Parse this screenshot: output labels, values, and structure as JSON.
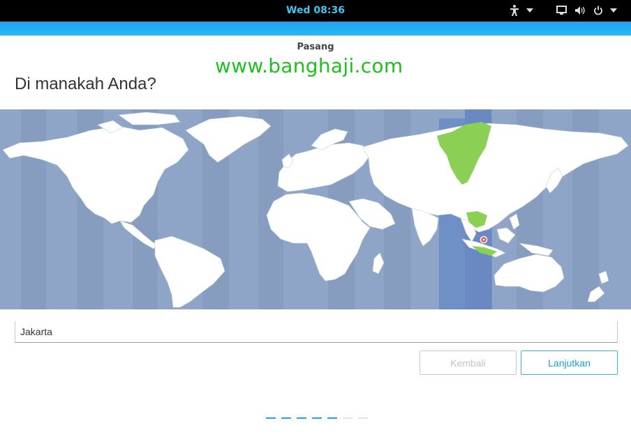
{
  "topbar": {
    "clock": "Wed 08:36",
    "icons": [
      "accessibility-icon",
      "chevron-down-icon",
      "display-icon",
      "volume-icon",
      "power-icon",
      "chevron-down-icon"
    ]
  },
  "window": {
    "title": "Pasang",
    "watermark": "www.banghaji.com",
    "heading": "Di manakah Anda?"
  },
  "map": {
    "selected_zone_color": "#6f8fc7",
    "highlight_region_color": "#8bcf55",
    "marker_color": "#e8473b"
  },
  "location": {
    "value": "Jakarta"
  },
  "buttons": {
    "back_label": "Kembali",
    "next_label": "Lanjutkan"
  },
  "progress": {
    "total_steps": 7,
    "completed_steps": 5
  },
  "colors": {
    "accent": "#1fa3ef",
    "clock": "#3fc6f2",
    "ocean": "#8fa5c7",
    "land": "#ffffff"
  }
}
